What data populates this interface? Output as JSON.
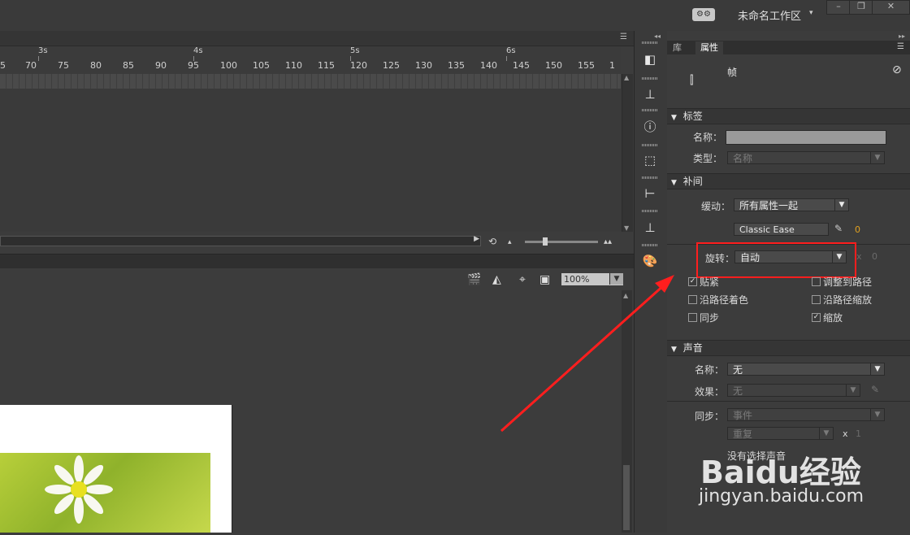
{
  "topbar": {
    "workspace_name": "未命名工作区",
    "workspace_arrow": "▾",
    "workspace_switch_icon": "gears-icon",
    "win_min": "–",
    "win_restore": "❐",
    "win_close": "✕"
  },
  "timeline": {
    "seconds": [
      "3s",
      "4s",
      "5s",
      "6s"
    ],
    "frames": [
      "5",
      "70",
      "75",
      "80",
      "85",
      "90",
      "95",
      "100",
      "105",
      "110",
      "115",
      "120",
      "125",
      "130",
      "135",
      "140",
      "145",
      "150",
      "155",
      "1"
    ],
    "loop_icon": "⟲",
    "zoom_small": "▴",
    "zoom_large": "▴▴"
  },
  "stage": {
    "zoom_value": "100%",
    "icons": [
      "clapper-icon",
      "symbol-icon",
      "center-stage-icon",
      "clip-icon"
    ]
  },
  "panel": {
    "tabs": [
      "库",
      "属性"
    ],
    "active_tab": "属性",
    "type_name": "帧",
    "label_section": {
      "title": "标签",
      "name_label": "名称：",
      "type_label": "类型：",
      "type_value": "名称"
    },
    "tween_section": {
      "title": "补间",
      "ease_label": "缓动：",
      "ease_value": "所有属性一起",
      "ease_preset": "Classic Ease",
      "ease_number": "0",
      "rotate_label": "旋转：",
      "rotate_value": "自动",
      "rotate_times_x": "x",
      "rotate_times": "0",
      "checkboxes": [
        {
          "label": "贴紧",
          "checked": true
        },
        {
          "label": "调整到路径",
          "checked": false
        },
        {
          "label": "沿路径着色",
          "checked": false
        },
        {
          "label": "沿路径缩放",
          "checked": false
        },
        {
          "label": "同步",
          "checked": false
        },
        {
          "label": "缩放",
          "checked": true
        }
      ]
    },
    "sound_section": {
      "title": "声音",
      "name_label": "名称：",
      "name_value": "无",
      "effect_label": "效果：",
      "effect_value": "无",
      "sync_label": "同步：",
      "sync_value": "事件",
      "repeat_value": "重复",
      "repeat_x": "x",
      "repeat_count": "1",
      "no_sound": "没有选择声音"
    }
  },
  "watermark": {
    "line1": "Baidu经验",
    "line2": "jingyan.baidu.com"
  },
  "colors": {
    "highlight": "#ff1e1e",
    "background": "#3c3c3c"
  }
}
